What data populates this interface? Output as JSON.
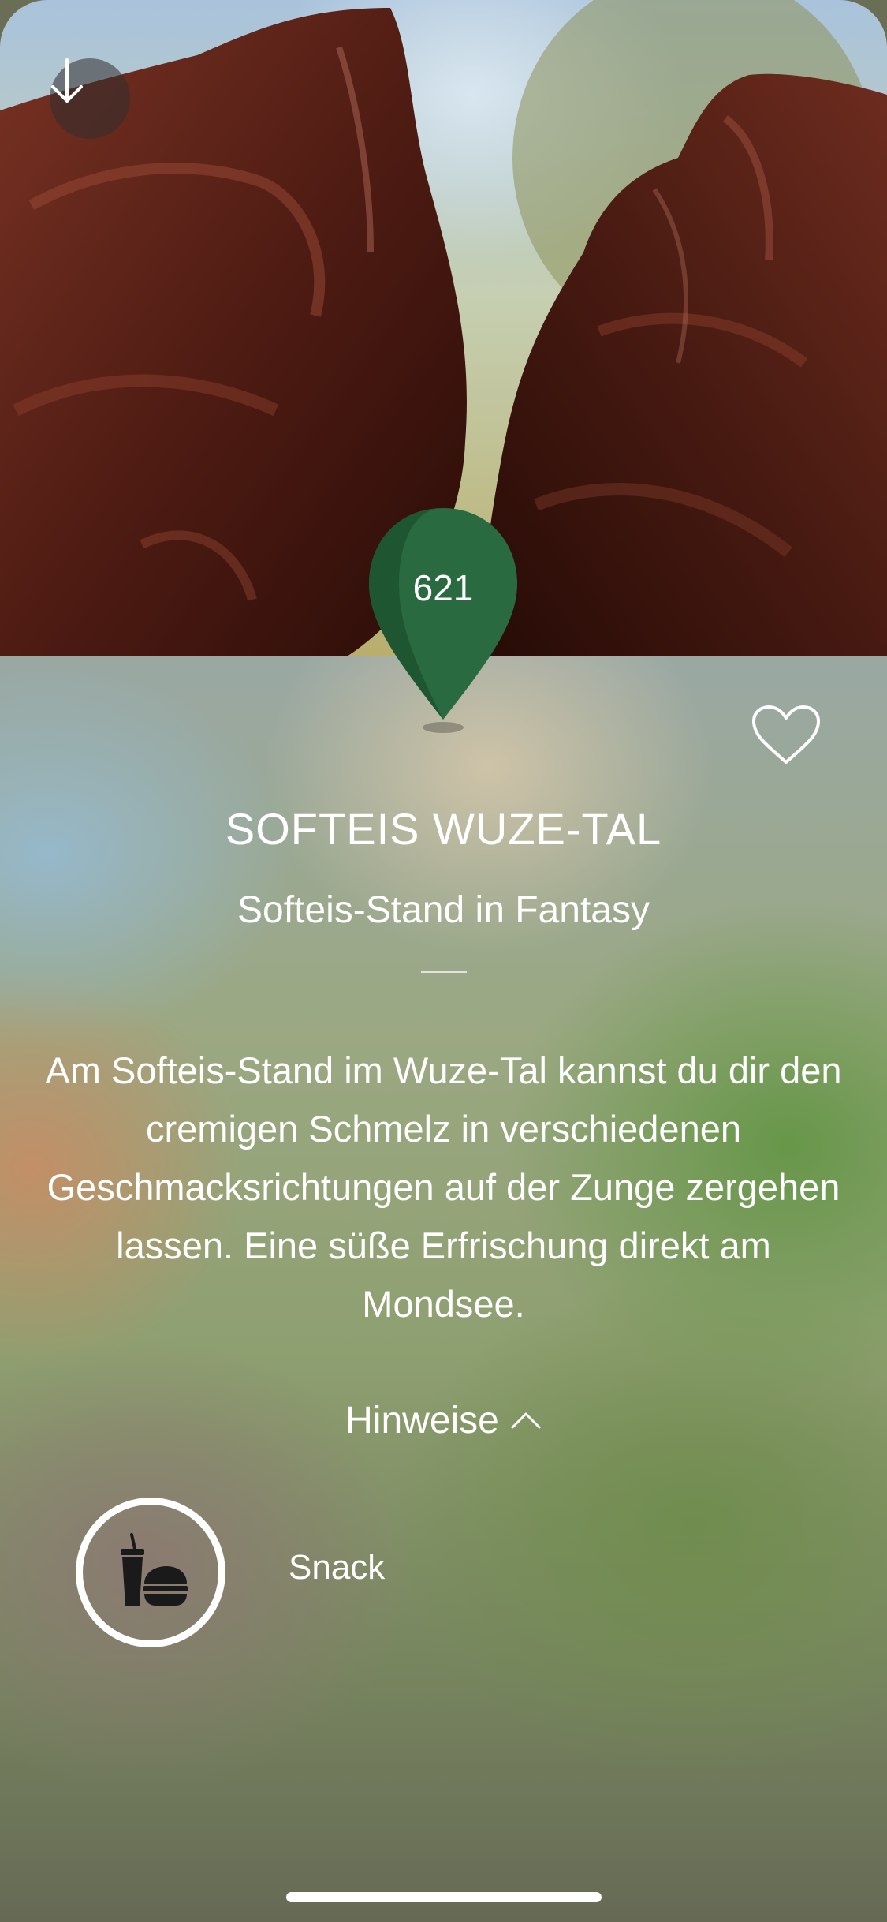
{
  "detail": {
    "pin_number": "621",
    "title": "SOFTEIS WUZE-TAL",
    "subtitle": "Softeis-Stand in Fantasy",
    "description": "Am Softeis-Stand im Wuze-Tal kannst du dir den cremigen Schmelz in verschiedenen Geschmacksrichtungen auf der Zunge zergehen lassen. Eine süße Erfrischung direkt am Mondsee.",
    "hints_label": "Hinweise",
    "hints_expanded": true,
    "categories": [
      {
        "label": "Snack",
        "icon": "snack-drink-burger-icon"
      }
    ],
    "favorite": false
  },
  "icons": {
    "back": "arrow-down-icon",
    "favorite": "heart-outline-icon",
    "hints_toggle": "chevron-up-icon",
    "pin": "map-pin-icon"
  },
  "colors": {
    "pin_green": "#2a6a40",
    "pin_green_dark": "#1f5632",
    "text": "#ffffff",
    "chocolate": "#4a1a12"
  }
}
